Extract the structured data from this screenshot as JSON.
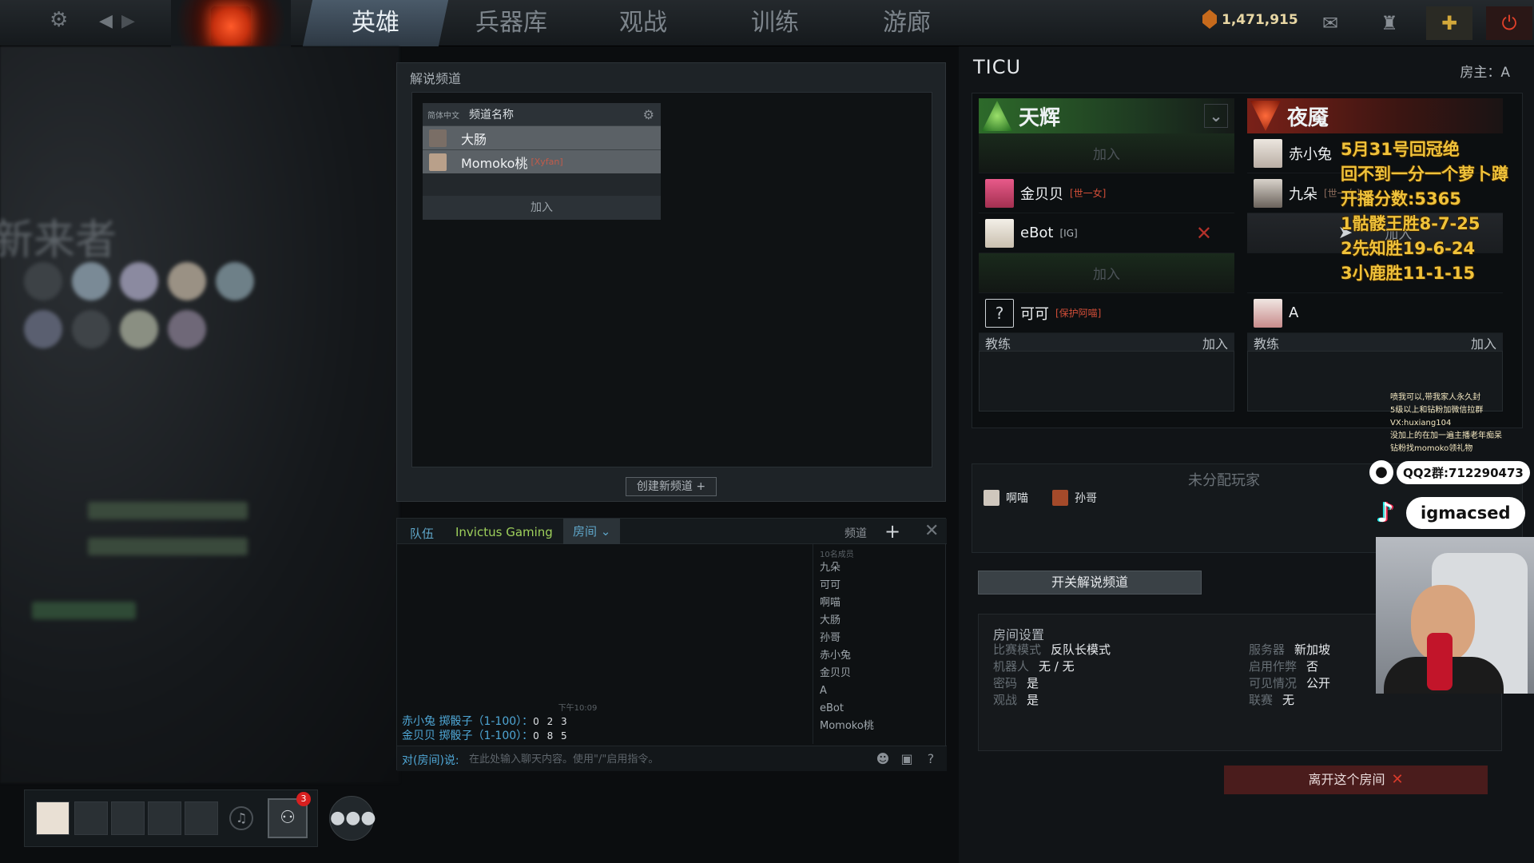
{
  "nav": {
    "tabs": [
      "英雄",
      "兵器库",
      "观战",
      "训练",
      "游廊"
    ],
    "shards": "1,471,915"
  },
  "left_bg": {
    "blur_text": "新来者"
  },
  "caster": {
    "title": "解说频道",
    "lang": "简体中文",
    "col_name": "频道名称",
    "channels": [
      {
        "name": "大肠",
        "tag": ""
      },
      {
        "name": "Momoko桃",
        "tag": "[Xyfan]"
      }
    ],
    "join": "加入",
    "create": "创建新频道"
  },
  "chat": {
    "tabs": {
      "team": "队伍",
      "guild": "Invictus Gaming",
      "room": "房间",
      "channel": "频道"
    },
    "time": "下午10:09",
    "lines": [
      {
        "text": "赤小兔 掷骰子（1-100）：",
        "num": "0 2 3"
      },
      {
        "text": "金贝贝 掷骰子（1-100）：",
        "num": "0 8 5"
      }
    ],
    "members_head": "10名成员",
    "members": [
      "九朵",
      "可可",
      "啊喵",
      "大肠",
      "孙哥",
      "赤小兔",
      "金贝贝",
      "A",
      "eBot",
      "Momoko桃"
    ],
    "prefix": "对(房间)说:",
    "placeholder": "在此处输入聊天内容。使用\"/\"启用指令。"
  },
  "lobby": {
    "title": "TICU",
    "host": "房主：A",
    "radiant": {
      "name": "天辉",
      "slots": [
        {
          "empty": true,
          "label": "加入"
        },
        {
          "name": "金贝贝",
          "tag": "[世一女]"
        },
        {
          "name": "eBot",
          "tag": "[IG]"
        },
        {
          "empty": true,
          "label": "加入"
        },
        {
          "name": "可可",
          "tag": "[保护阿喵]"
        }
      ],
      "coach": "教练",
      "coach_join": "加入"
    },
    "dire": {
      "name": "夜魇",
      "slots": [
        {
          "name": "赤小兔",
          "tag": ""
        },
        {
          "name": "九朵",
          "tag": "[世一女]"
        },
        {
          "empty": true,
          "label": "加入"
        },
        {
          "empty": true,
          "label": ""
        },
        {
          "name": "A",
          "tag": ""
        }
      ],
      "coach": "教练",
      "coach_join": "加入"
    },
    "unassigned_title": "未分配玩家",
    "unassigned": [
      "啊喵",
      "孙哥"
    ],
    "toggle_caster": "开关解说频道",
    "settings_title": "房间设置",
    "settings_left": [
      {
        "k": "比赛模式",
        "v": "反队长模式"
      },
      {
        "k": "机器人",
        "v": "无 / 无"
      },
      {
        "k": "密码",
        "v": "是"
      },
      {
        "k": "观战",
        "v": "是"
      }
    ],
    "settings_right": [
      {
        "k": "服务器",
        "v": "新加坡"
      },
      {
        "k": "启用作弊",
        "v": "否"
      },
      {
        "k": "可见情况",
        "v": "公开"
      },
      {
        "k": "联赛",
        "v": "无"
      }
    ],
    "leave": "离开这个房间"
  },
  "overlay": {
    "lines": [
      "5月31号回冠绝",
      "回不到一分一个萝卜蹲",
      "开播分数:5365",
      "1骷髅王胜8-7-25",
      "2先知胜19-6-24",
      "3小鹿胜11-1-15"
    ],
    "promo": [
      "喷我可以,带我家人永久封",
      "5级以上和钻粉加微信拉群",
      "VX:huxiang104",
      "没加上的在加一遍主播老年痴呆",
      "钻粉找momoko领礼物"
    ],
    "qq": "QQ2群:712290473",
    "tiktok": "igmacsed"
  },
  "party": {
    "badge": "3"
  },
  "colors": {
    "radiant": "#2d6a2a",
    "dire": "#7a2118",
    "chat_blue": "#4fa7d6",
    "overlay_gold": "#f0c23a"
  }
}
